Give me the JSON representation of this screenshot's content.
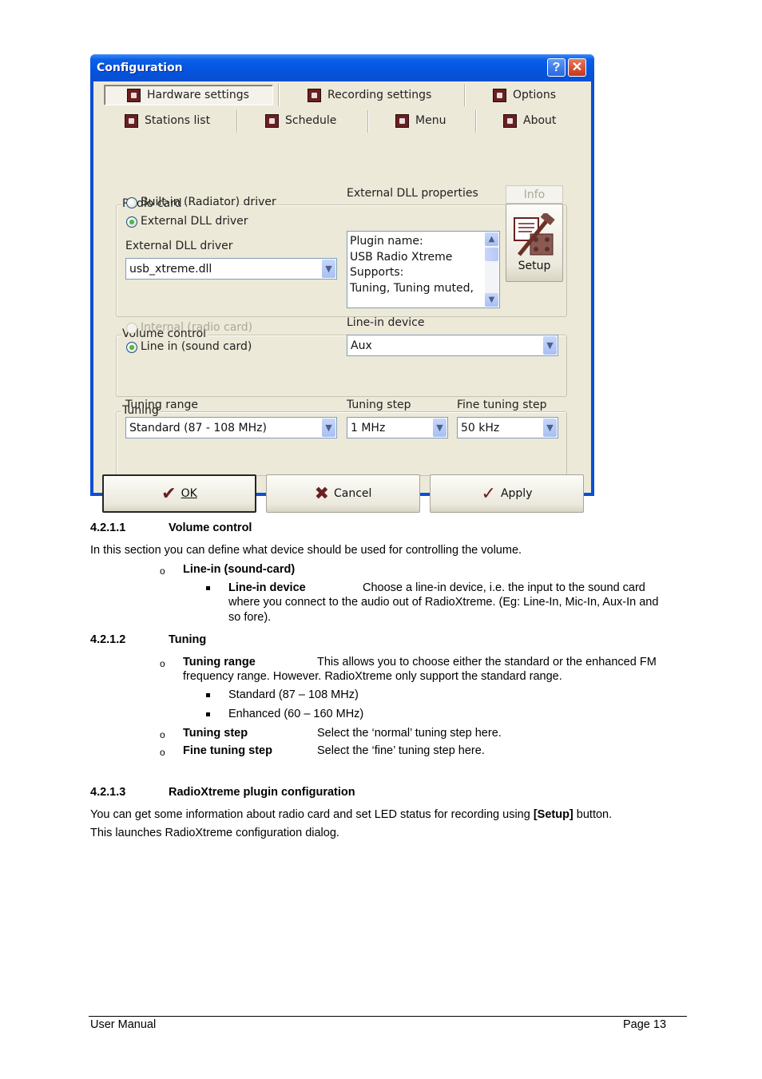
{
  "dialog": {
    "title": "Configuration",
    "help_button": "?",
    "close_button": "✕",
    "tabs": [
      {
        "label": "Hardware settings",
        "icon": "hardware-icon",
        "active": true
      },
      {
        "label": "Recording settings",
        "icon": "record-icon",
        "active": false
      },
      {
        "label": "Options",
        "icon": "computer-icon",
        "active": false
      },
      {
        "label": "Stations list",
        "icon": "waveform-icon",
        "active": false
      },
      {
        "label": "Schedule",
        "icon": "clock-icon",
        "active": false
      },
      {
        "label": "Menu",
        "icon": "menu-icon",
        "active": false
      },
      {
        "label": "About",
        "icon": "broadcast-icon",
        "active": false
      }
    ],
    "radio_card": {
      "legend": "Radio card",
      "options": [
        {
          "label": "Built-in (Radiator) driver",
          "checked": false
        },
        {
          "label": "External DLL driver",
          "checked": true
        }
      ],
      "dll_label": "External DLL driver",
      "dll_value": "usb_xtreme.dll",
      "properties_label": "External DLL properties",
      "properties_lines": [
        "Plugin name:",
        "USB Radio Xtreme",
        "Supports:",
        "Tuning, Tuning muted,"
      ],
      "info_button": "Info",
      "setup_button": "Setup"
    },
    "volume_control": {
      "legend": "Volume control",
      "options": [
        {
          "label": "Internal (radio card)",
          "checked": false,
          "disabled": true
        },
        {
          "label": "Line in (sound card)",
          "checked": true,
          "disabled": false
        }
      ],
      "device_label": "Line-in device",
      "device_value": "Aux"
    },
    "tuning": {
      "legend": "Tuning",
      "range_label": "Tuning range",
      "range_value": "Standard (87 - 108 MHz)",
      "step_label": "Tuning step",
      "step_value": "1 MHz",
      "fine_label": "Fine tuning step",
      "fine_value": "50 kHz"
    },
    "buttons": {
      "ok": "OK",
      "cancel": "Cancel",
      "apply": "Apply"
    }
  },
  "doc": {
    "s1": {
      "number": "4.2.1.1",
      "title": "Volume control",
      "intro": "In this section you can define what device should be used for controlling the volume.",
      "item": "Line-in (sound-card)",
      "sub_term": "Line-in device",
      "sub_text_1": "Choose a line-in device, i.e. the input to the sound card",
      "sub_text_2": "where you connect to the audio out of RadioXtreme. (Eg: Line-In, Mic-In, Aux-In and",
      "sub_text_3": "so fore)."
    },
    "s2": {
      "number": "4.2.1.2",
      "title": "Tuning",
      "range_term": "Tuning range",
      "range_text_1": "This allows you to choose either the standard or the enhanced FM",
      "range_text_2": "frequency range. However. RadioXtreme only support the standard range.",
      "range_opt_1": "Standard (87 – 108 MHz)",
      "range_opt_2": "Enhanced (60 – 160 MHz)",
      "step_term": "Tuning step",
      "step_text": "Select the ‘normal’ tuning step here.",
      "fine_term": "Fine tuning step",
      "fine_text": "Select the ‘fine’ tuning step here."
    },
    "s3": {
      "number": "4.2.1.3",
      "title": "RadioXtreme plugin configuration",
      "text_1a": "You can get some information about radio card and set LED status for recording using ",
      "text_1b": "[Setup]",
      "text_1c": " button.",
      "text_2": "This launches RadioXtreme configuration dialog."
    }
  },
  "footer": {
    "left": "User Manual",
    "right": "Page 13"
  }
}
